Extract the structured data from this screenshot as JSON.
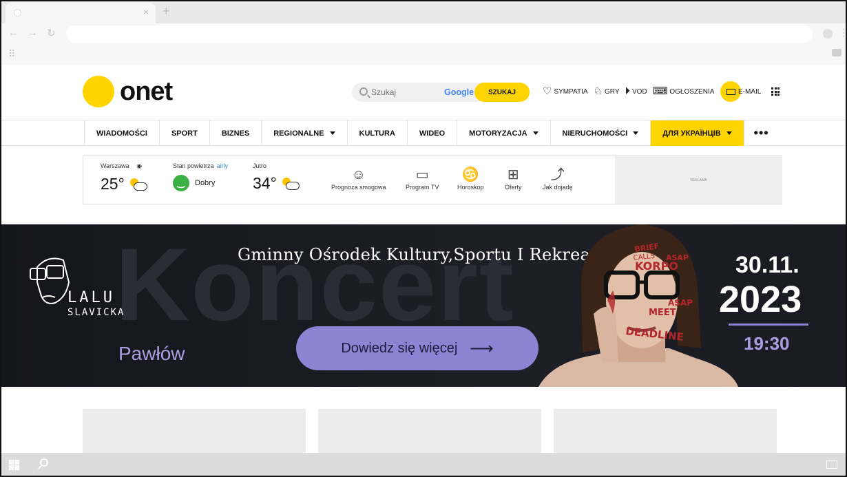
{
  "browser": {
    "new_tab": "+",
    "close_tab": "×"
  },
  "header": {
    "logo": "onet",
    "search": {
      "placeholder": "Szukaj",
      "google": "Google",
      "button": "SZUKAJ"
    },
    "links": [
      {
        "icon": "heart-icon",
        "label": "SYMPATIA"
      },
      {
        "icon": "chess-knight-icon",
        "label": "GRY"
      },
      {
        "icon": "play-icon",
        "label": "VOD"
      },
      {
        "icon": "keyboard-icon",
        "label": "OGŁOSZENIA"
      }
    ],
    "email": "E-MAIL"
  },
  "nav": {
    "items": [
      "WIADOMOŚCI",
      "SPORT",
      "BIZNES",
      "REGIONALNE",
      "KULTURA",
      "WIDEO",
      "MOTORYZACJA",
      "NIERUCHOMOŚCI",
      "ДЛЯ УКРАЇНЦІВ"
    ],
    "more": "•••"
  },
  "weather": {
    "city": "Warszawa",
    "temp_now": "25°",
    "air_label": "Stan powietrza",
    "air_provider": "airly",
    "air_status": "Dobry",
    "tomorrow_label": "Jutro",
    "temp_tomorrow": "34°",
    "tools": [
      {
        "icon": "mask-icon",
        "label": "Prognoza smogowa"
      },
      {
        "icon": "tv-icon",
        "label": "Program TV"
      },
      {
        "icon": "cancer-zodiac-icon",
        "label": "Horoskop"
      },
      {
        "icon": "gift-icon",
        "label": "Oferty"
      },
      {
        "icon": "route-icon",
        "label": "Jak dojadę"
      }
    ],
    "ad_label": "REKLAMA"
  },
  "banner": {
    "bg_word": "Koncert",
    "title": "Gminny Ośrodek Kultury,Sportu I Rekreacji",
    "brand_name": "LALU",
    "brand_sub": "SLAVICKA",
    "city": "Pawłów",
    "cta": "Dowiedz się więcej",
    "date_day": "30.11.",
    "date_year": "2023",
    "time": "19:30",
    "face_words": [
      "BRIEF",
      "CALLS",
      "ASAP",
      "KORPO",
      "MEET",
      "DEADLINE",
      "ASAP"
    ]
  },
  "colors": {
    "accent": "#ffd400",
    "banner_purple": "#8c84d2"
  }
}
